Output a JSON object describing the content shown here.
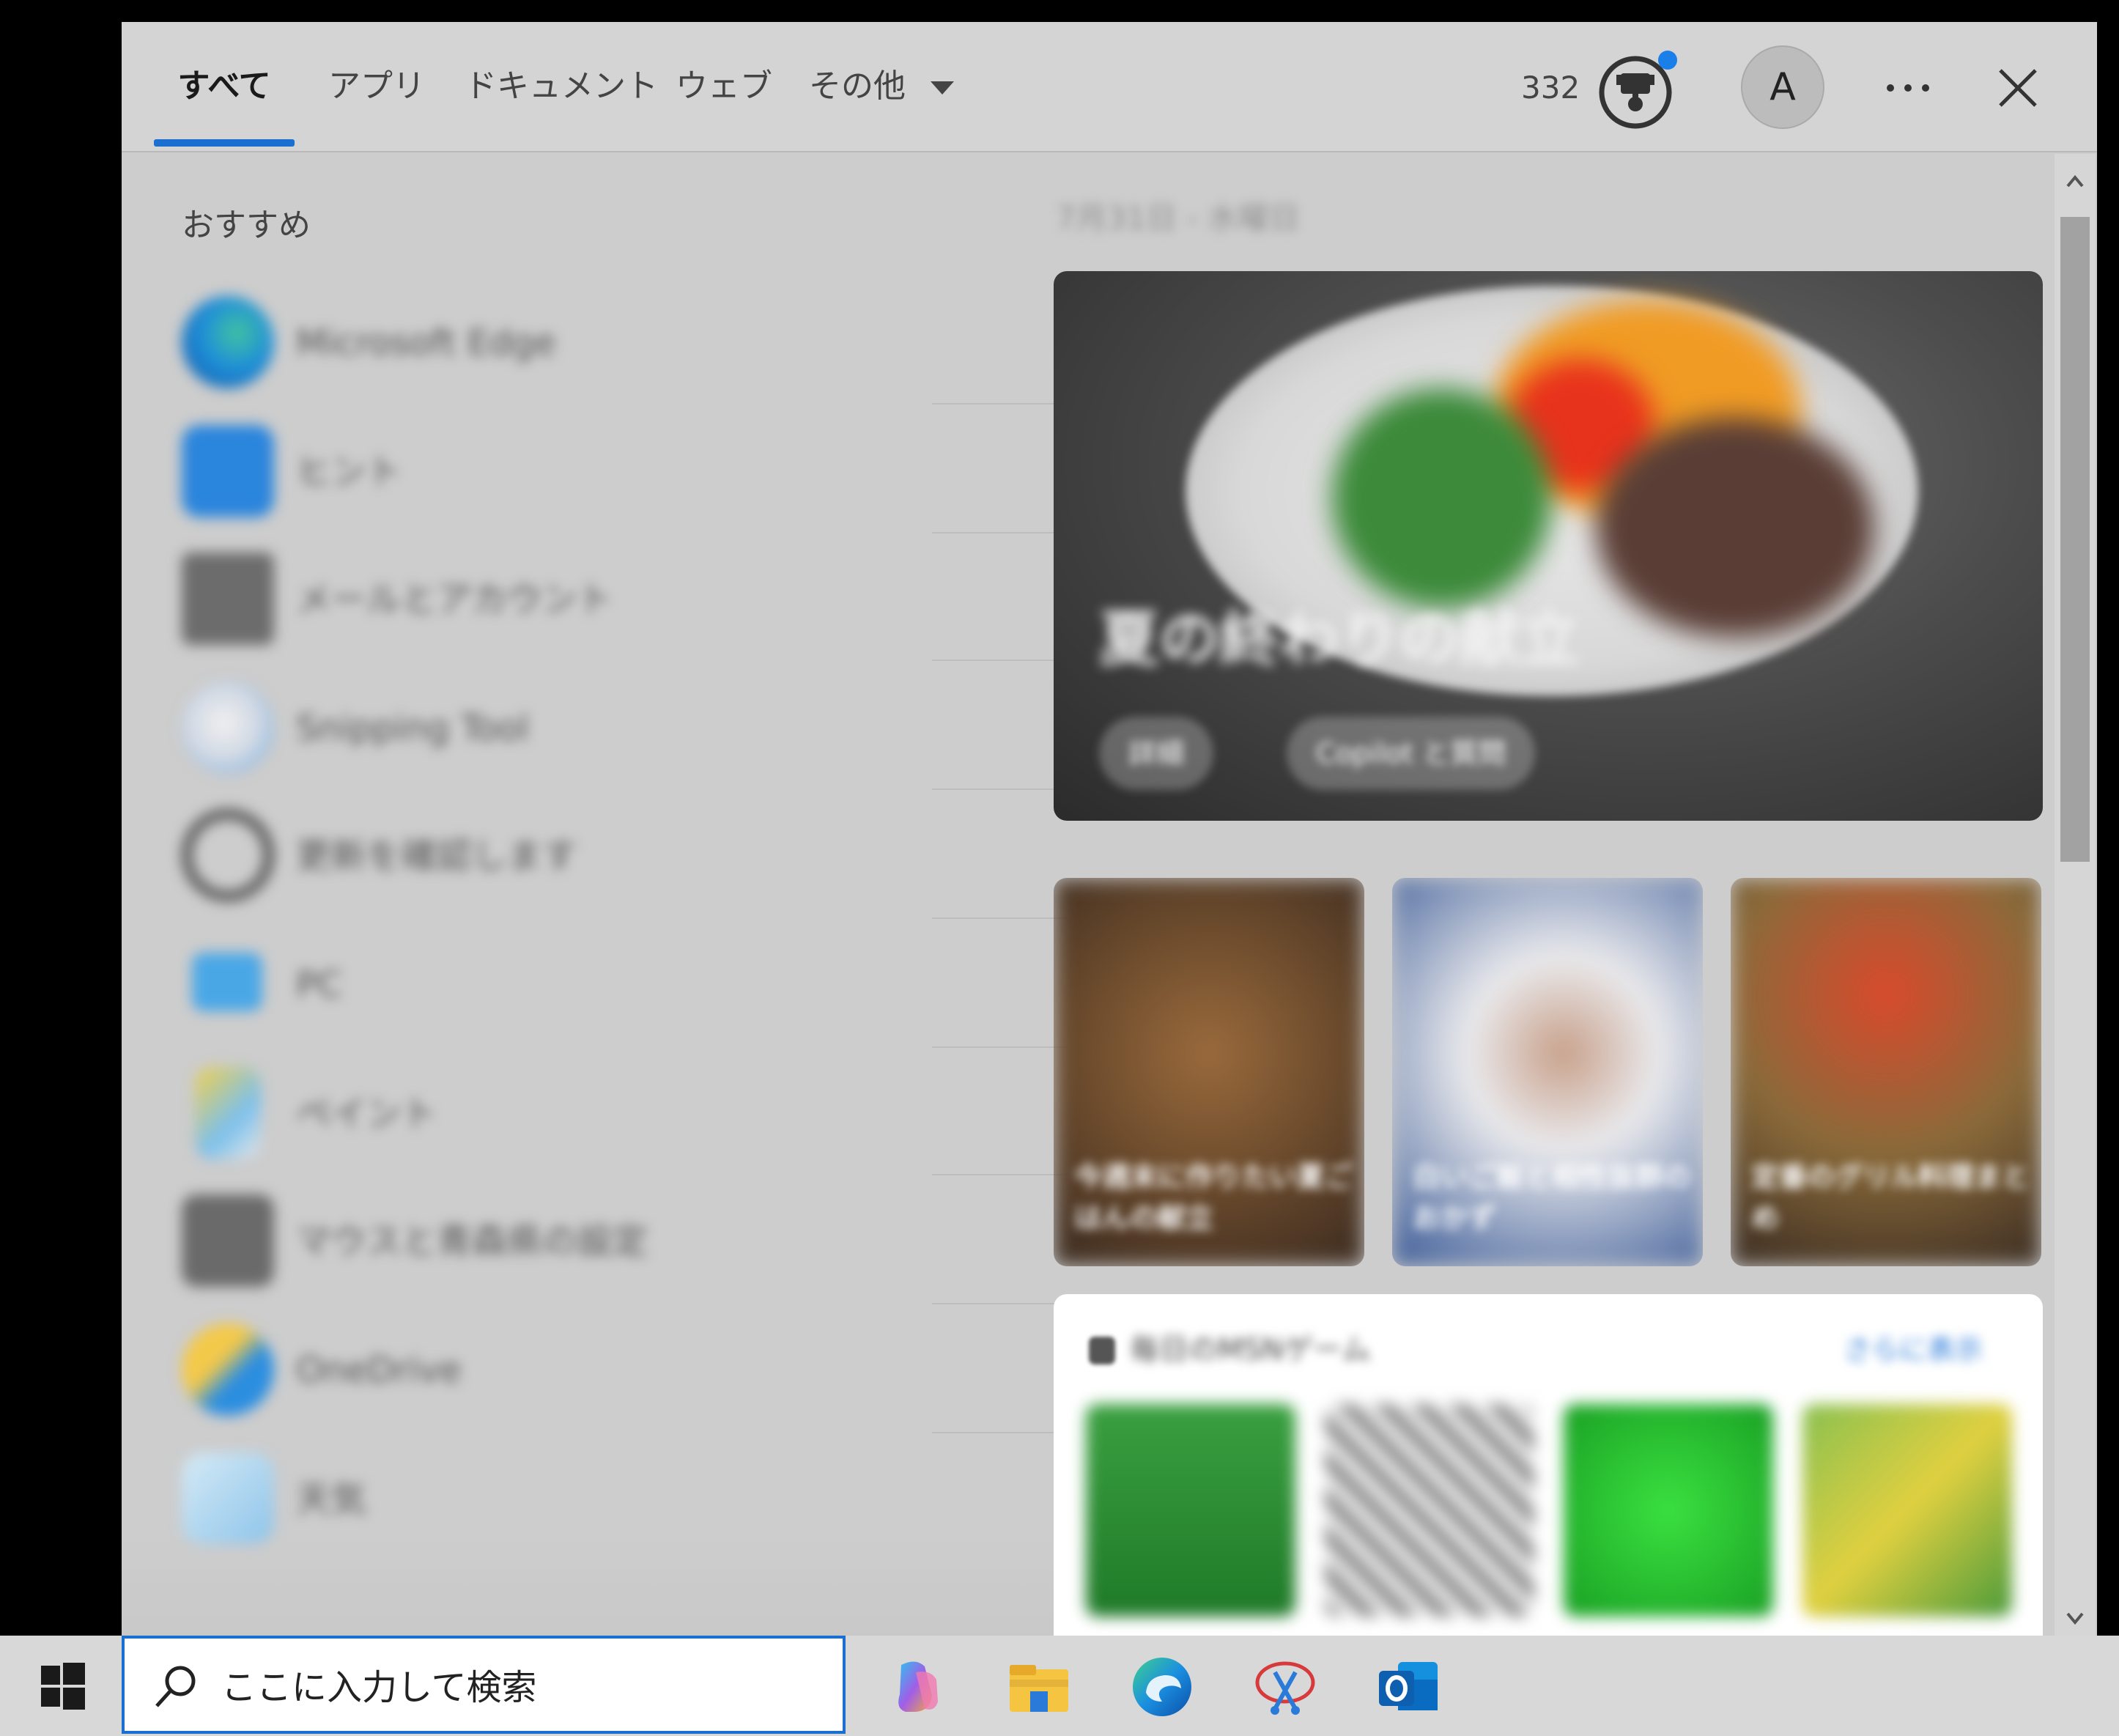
{
  "tabs": [
    {
      "label": "すべて"
    },
    {
      "label": "アプリ"
    },
    {
      "label": "ドキュメント"
    },
    {
      "label": "ウェブ"
    },
    {
      "label": "その他"
    }
  ],
  "header": {
    "points": "332",
    "avatar_initial": "A"
  },
  "recommended": {
    "title": "おすすめ",
    "items": [
      {
        "label": "Microsoft Edge",
        "icon": "edge-icon"
      },
      {
        "label": "ヒント",
        "icon": "tips-icon"
      },
      {
        "label": "メールとアカウント",
        "icon": "mail-accounts-icon"
      },
      {
        "label": "Snipping Tool",
        "icon": "snipping-tool-icon"
      },
      {
        "label": "更新を確認します",
        "icon": "update-icon"
      },
      {
        "label": "PC",
        "icon": "pc-icon"
      },
      {
        "label": "ペイント",
        "icon": "paint-icon"
      },
      {
        "label": "マウスと青森県の設定",
        "icon": "mouse-settings-icon"
      },
      {
        "label": "OneDrive",
        "icon": "onedrive-icon"
      },
      {
        "label": "天気",
        "icon": "weather-icon"
      }
    ]
  },
  "feed": {
    "breadcrumb": "7月31日 - 水曜日",
    "hero": {
      "title": "夏の終わりの献立",
      "button_details": "詳細",
      "button_copilot": "Copilot と質問"
    },
    "cards": [
      {
        "title": "今週末に作りたい夏ごはんの献立"
      },
      {
        "title": "白いご飯と相性抜群のおかず"
      },
      {
        "title": "定番のグリル料理まとめ"
      }
    ],
    "games": {
      "title": "毎日のMSNゲーム",
      "link": "さらに表示"
    }
  },
  "taskbar": {
    "search_placeholder": "ここに入力して検索"
  },
  "colors": {
    "accent": "#1a6fd0",
    "panel_bg": "#cdcdcd",
    "notification_dot": "#1a7fe8"
  }
}
